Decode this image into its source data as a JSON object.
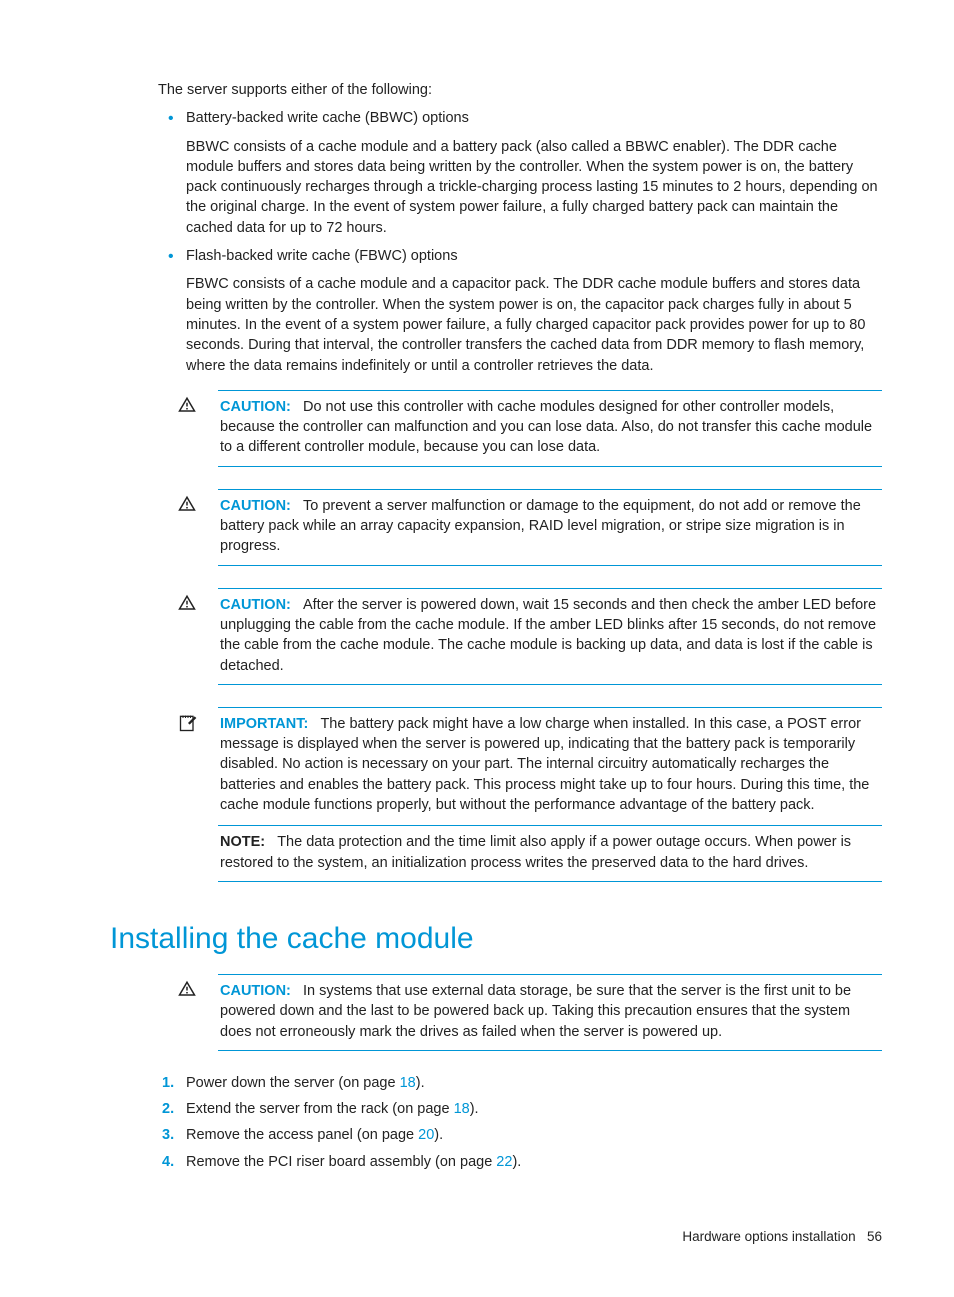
{
  "intro": "The server supports either of the following:",
  "bullets": [
    {
      "title": "Battery-backed write cache (BBWC) options",
      "body": "BBWC consists of a cache module and a battery pack (also called a BBWC enabler). The DDR cache module buffers and stores data being written by the controller. When the system power is on, the battery pack continuously recharges through a trickle-charging process lasting 15 minutes to 2 hours, depending on the original charge.   In the event of system power failure, a fully charged battery pack can maintain the cached data for up to 72 hours."
    },
    {
      "title": "Flash-backed write cache (FBWC) options",
      "body": "FBWC consists of a cache module and a capacitor pack. The DDR cache module buffers and stores data being written by the controller. When the system power is on, the capacitor pack charges fully in about 5 minutes. In the event of a system power failure, a fully charged capacitor pack provides power for up to 80 seconds. During that interval, the controller transfers the cached data from DDR memory to flash memory, where the data remains indefinitely or until a controller retrieves the data."
    }
  ],
  "callouts": [
    {
      "label": "CAUTION:",
      "type": "caution",
      "text": "Do not use this controller with cache modules designed for other controller models, because the controller can malfunction and you can lose data. Also, do not transfer this cache module to a different controller module, because you can lose data."
    },
    {
      "label": "CAUTION:",
      "type": "caution",
      "text": "To prevent a server malfunction or damage to the equipment, do not add or remove the battery pack while an array capacity expansion, RAID level migration, or stripe size migration is in progress."
    },
    {
      "label": "CAUTION:",
      "type": "caution",
      "text": "After the server is powered down, wait 15 seconds and then check the amber LED before unplugging the cable from the cache module. If the amber LED blinks after 15 seconds, do not remove the cable from the cache module. The cache module is backing up data, and data is lost if the cable is detached."
    },
    {
      "label": "IMPORTANT:",
      "type": "important",
      "text": "The battery pack might have a low charge when installed. In this case, a POST error message is displayed when the server is powered up, indicating that the battery pack is temporarily disabled. No action is necessary on your part. The internal circuitry automatically recharges the batteries and enables the battery pack. This process might take up to four hours. During this time, the cache module functions properly, but without the performance advantage of the battery pack."
    },
    {
      "label": "NOTE:",
      "type": "note",
      "text": "The data protection and the time limit also apply if a power outage occurs. When power is restored to the system, an initialization process writes the preserved data to the hard drives."
    }
  ],
  "section_heading": "Installing the cache module",
  "section_callout": {
    "label": "CAUTION:",
    "type": "caution",
    "text": "In systems that use external data storage, be sure that the server is the first unit to be powered down and the last to be powered back up. Taking this precaution ensures that the system does not erroneously mark the drives as failed when the server is powered up."
  },
  "steps": [
    {
      "pre": "Power down the server (on page ",
      "ref": "18",
      "post": ")."
    },
    {
      "pre": "Extend the server from the rack (on page ",
      "ref": "18",
      "post": ")."
    },
    {
      "pre": "Remove the access panel (on page ",
      "ref": "20",
      "post": ")."
    },
    {
      "pre": "Remove the PCI riser board assembly (on page ",
      "ref": "22",
      "post": ")."
    }
  ],
  "footer": {
    "title": "Hardware options installation",
    "page": "56"
  }
}
